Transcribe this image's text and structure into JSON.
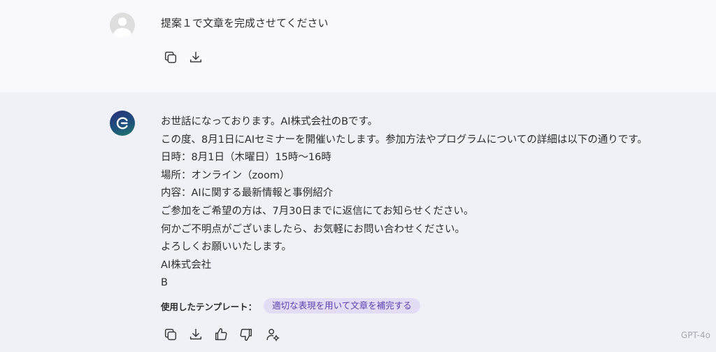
{
  "user_message": {
    "text": "提案１で文章を完成させてください"
  },
  "assistant_message": {
    "lines": [
      "お世話になっております。AI株式会社のBです。",
      "この度、8月1日にAIセミナーを開催いたします。参加方法やプログラムについての詳細は以下の通りです。",
      "日時：8月1日（木曜日）15時〜16時",
      "場所：オンライン（zoom）",
      "内容：AIに関する最新情報と事例紹介",
      "ご参加をご希望の方は、7月30日までに返信にてお知らせください。",
      "何かご不明点がございましたら、お気軽にお問い合わせください。",
      "よろしくお願いいたします。",
      "AI株式会社",
      "B"
    ],
    "template_label": "使用したテンプレート：",
    "template_name": "適切な表現を用いて文章を補完する",
    "model": "GPT-4o"
  },
  "icons": {
    "user_actions": [
      "copy-icon",
      "download-icon"
    ],
    "assistant_actions": [
      "copy-icon",
      "download-icon",
      "thumbs-up-icon",
      "thumbs-down-icon",
      "user-settings-icon"
    ]
  },
  "colors": {
    "user_bg": "#f9f9fb",
    "assistant_bg": "#f0f1f6",
    "chip_bg": "#e3dcf5",
    "chip_text": "#5b3fae"
  }
}
